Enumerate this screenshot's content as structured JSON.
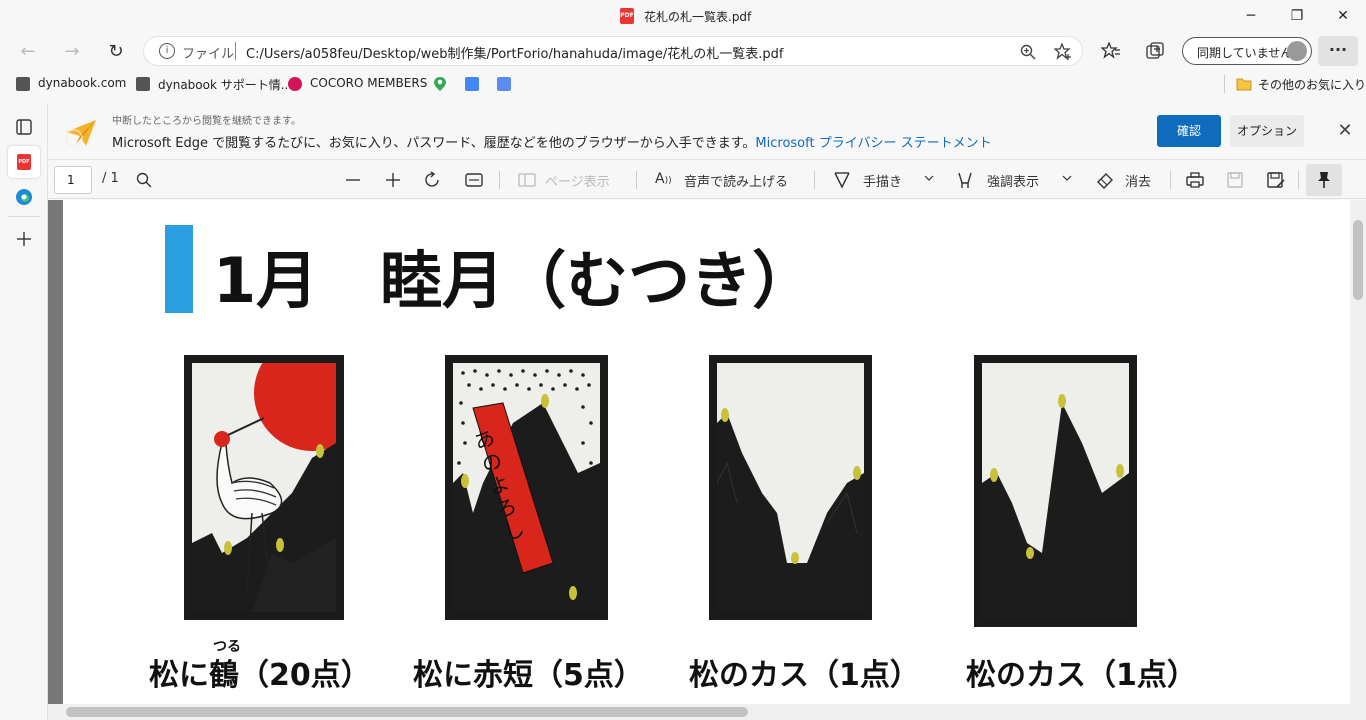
{
  "window": {
    "title": "花札の札一覧表.pdf",
    "minimize": "─",
    "restore": "❐",
    "close": "✕"
  },
  "navbar": {
    "back": "←",
    "forward": "→",
    "reload": "↻",
    "address_scheme": "ファイル",
    "address_url": "C:/Users/a058feu/Desktop/web制作集/PortForio/hanahuda/image/花札の札一覧表.pdf",
    "sync_label": "同期していません",
    "more": "···"
  },
  "favorites": {
    "items": [
      {
        "label": "dynabook.com"
      },
      {
        "label": "dynabook サポート情..."
      },
      {
        "label": "COCORO MEMBERS"
      }
    ],
    "other_label": "その他のお気に入り"
  },
  "infobar": {
    "small_text": "中断したところから閲覧を継続できます。",
    "main_text": "Microsoft Edge で閲覧するたびに、お気に入り、パスワード、履歴などを他のブラウザーから入手できます。",
    "link_text": "Microsoft プライバシー ステートメント",
    "confirm_label": "確認",
    "option_label": "オプション"
  },
  "pdf_toolbar": {
    "page_current": "1",
    "page_total": "/ 1",
    "page_view_label": "ページ表示",
    "read_aloud_label": "音声で読み上げる",
    "draw_label": "手描き",
    "highlight_label": "強調表示",
    "erase_label": "消去"
  },
  "document": {
    "heading": "1月　睦月（むつき）",
    "ruby": "つる",
    "cards": [
      {
        "name": "松に鶴（20点）",
        "type": "crane"
      },
      {
        "name": "松に赤短（5点）",
        "type": "ribbon",
        "poem": "あのよろし"
      },
      {
        "name": "松のカス（1点）",
        "type": "plain"
      },
      {
        "name": "松のカス（1点）",
        "type": "plain"
      }
    ]
  },
  "colors": {
    "accent": "#0f6cbd",
    "heading_bar": "#2b9ee0",
    "card_red": "#d9261c",
    "pine": "#1c1c1c",
    "pine_tip": "#c8c23a"
  }
}
